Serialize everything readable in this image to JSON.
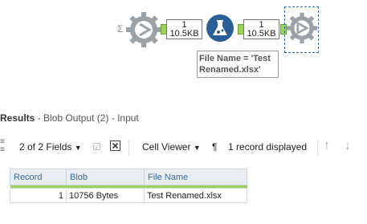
{
  "canvas": {
    "sigma": "Σ",
    "count_left": {
      "records": "1",
      "size": "10.5KB"
    },
    "count_right": {
      "records": "1",
      "size": "10.5KB"
    },
    "annotation": "File Name = 'Test Renamed.xlsx'",
    "colors": {
      "tool_gray": "#9aa2a8",
      "formula_blue": "#2a5e96",
      "anchor_green": "#9bd35a"
    }
  },
  "results": {
    "title": "Results",
    "subtitle": " - Blob Output (2) - Input",
    "toolbar": {
      "fields": "2 of 2 Fields",
      "cell_viewer": "Cell Viewer",
      "records_displayed": "1 record displayed"
    },
    "table": {
      "headers": [
        "Record",
        "Blob",
        "File Name"
      ],
      "rows": [
        {
          "record": "1",
          "blob": "10756 Bytes",
          "file_name": "Test Renamed.xlsx"
        }
      ]
    }
  }
}
